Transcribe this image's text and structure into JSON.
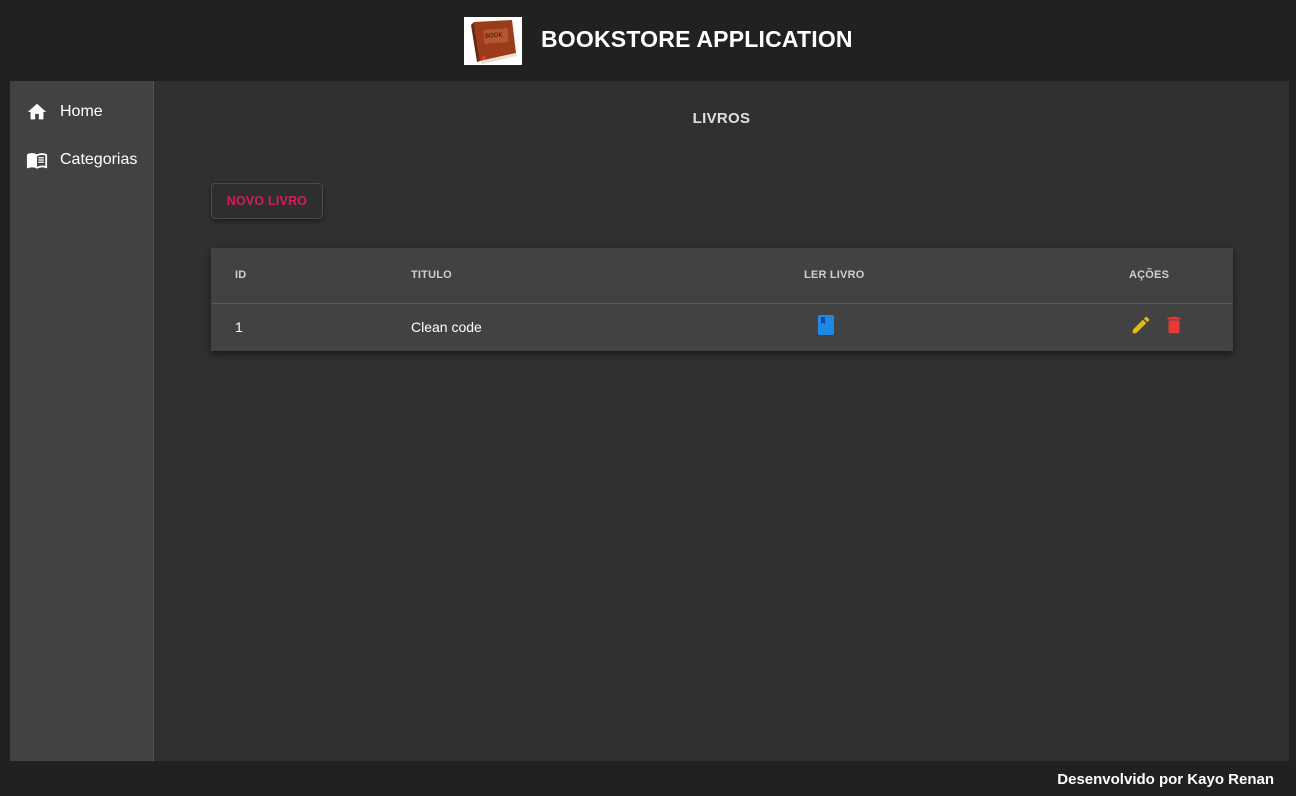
{
  "header": {
    "title": "BOOKSTORE APPLICATION",
    "logo_icon": "book-logo-icon"
  },
  "sidebar": {
    "items": [
      {
        "label": "Home",
        "icon": "home-icon"
      },
      {
        "label": "Categorias",
        "icon": "open-book-icon"
      }
    ]
  },
  "main": {
    "page_title": "LIVROS",
    "new_button_label": "NOVO LIVRO",
    "table": {
      "columns": [
        "ID",
        "TITULO",
        "LER LIVRO",
        "AÇÕES"
      ],
      "rows": [
        {
          "id": "1",
          "title": "Clean code",
          "read_icon": "book-icon",
          "actions": [
            "edit-icon",
            "delete-icon"
          ]
        }
      ]
    }
  },
  "footer": {
    "text": "Desenvolvido por Kayo Renan"
  },
  "colors": {
    "accent": "#d81b60",
    "edit": "#e0b81f",
    "delete": "#e53935",
    "read": "#1e88e5"
  }
}
